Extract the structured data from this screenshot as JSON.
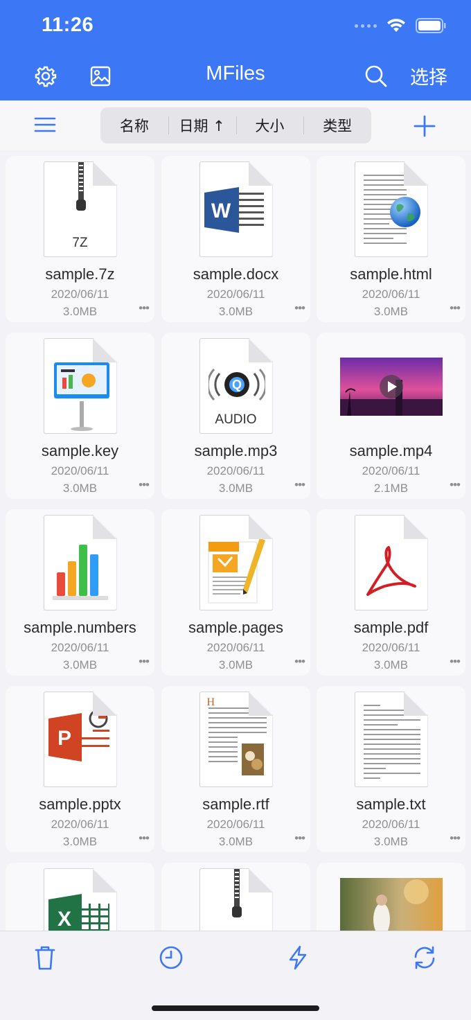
{
  "status": {
    "time": "11:26"
  },
  "nav": {
    "title": "MFiles",
    "select_label": "选择"
  },
  "sort": {
    "name": "名称",
    "date": "日期 ↑",
    "size": "大小",
    "type": "类型"
  },
  "files": [
    {
      "name": "sample.7z",
      "date": "2020/06/11",
      "size": "3.0MB",
      "icon": "archive-7z-icon",
      "label": "7Z"
    },
    {
      "name": "sample.docx",
      "date": "2020/06/11",
      "size": "3.0MB",
      "icon": "word-doc-icon"
    },
    {
      "name": "sample.html",
      "date": "2020/06/11",
      "size": "3.0MB",
      "icon": "html-globe-icon"
    },
    {
      "name": "sample.key",
      "date": "2020/06/11",
      "size": "3.0MB",
      "icon": "keynote-icon"
    },
    {
      "name": "sample.mp3",
      "date": "2020/06/11",
      "size": "3.0MB",
      "icon": "audio-icon",
      "label": "AUDIO"
    },
    {
      "name": "sample.mp4",
      "date": "2020/06/11",
      "size": "2.1MB",
      "icon": "video-thumbnail"
    },
    {
      "name": "sample.numbers",
      "date": "2020/06/11",
      "size": "3.0MB",
      "icon": "numbers-icon"
    },
    {
      "name": "sample.pages",
      "date": "2020/06/11",
      "size": "3.0MB",
      "icon": "pages-icon"
    },
    {
      "name": "sample.pdf",
      "date": "2020/06/11",
      "size": "3.0MB",
      "icon": "pdf-icon"
    },
    {
      "name": "sample.pptx",
      "date": "2020/06/11",
      "size": "3.0MB",
      "icon": "powerpoint-icon"
    },
    {
      "name": "sample.rtf",
      "date": "2020/06/11",
      "size": "3.0MB",
      "icon": "rtf-doc-icon"
    },
    {
      "name": "sample.txt",
      "date": "2020/06/11",
      "size": "3.0MB",
      "icon": "txt-doc-icon"
    }
  ],
  "partial_row": [
    "excel-icon",
    "zip-icon",
    "image-thumbnail"
  ],
  "colors": {
    "accent": "#3c78f5",
    "background": "#f2f2f7"
  }
}
